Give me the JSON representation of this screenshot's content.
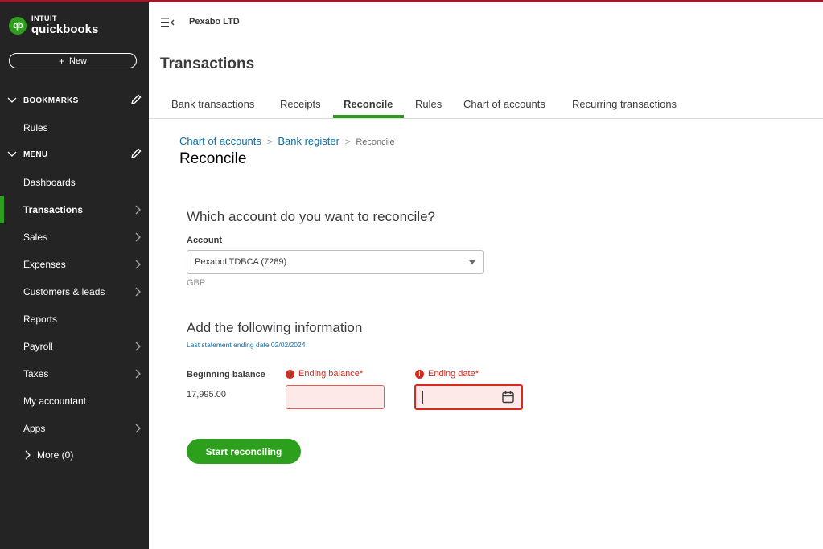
{
  "brand": {
    "intuit": "INTUIT",
    "product": "quickbooks",
    "mark": "qb",
    "accent_color": "#2ca01c",
    "sidebar_bg": "#242424"
  },
  "sidebar": {
    "new_label": "New",
    "bookmarks_label": "BOOKMARKS",
    "bookmarks": [
      {
        "label": "Rules"
      }
    ],
    "menu_label": "MENU",
    "items": [
      {
        "label": "Dashboards",
        "has_submenu": false
      },
      {
        "label": "Transactions",
        "has_submenu": true,
        "active": true
      },
      {
        "label": "Sales",
        "has_submenu": true
      },
      {
        "label": "Expenses",
        "has_submenu": true
      },
      {
        "label": "Customers & leads",
        "has_submenu": true
      },
      {
        "label": "Reports",
        "has_submenu": false
      },
      {
        "label": "Payroll",
        "has_submenu": true
      },
      {
        "label": "Taxes",
        "has_submenu": true
      },
      {
        "label": "My accountant",
        "has_submenu": false
      },
      {
        "label": "Apps",
        "has_submenu": true
      }
    ],
    "more_label": "More (0)"
  },
  "header": {
    "company": "Pexabo LTD",
    "page_title": "Transactions"
  },
  "tabs": [
    {
      "label": "Bank transactions"
    },
    {
      "label": "Receipts"
    },
    {
      "label": "Reconcile",
      "active": true
    },
    {
      "label": "Rules"
    },
    {
      "label": "Chart of accounts"
    },
    {
      "label": "Recurring transactions"
    }
  ],
  "breadcrumb": {
    "item1": "Chart of accounts",
    "item2": "Bank register",
    "current": "Reconcile",
    "separator": ">"
  },
  "reconcile": {
    "title": "Reconcile",
    "question": "Which account do you want to reconcile?",
    "account_label": "Account",
    "account_value": "PexaboLTDBCA (7289)",
    "currency": "GBP",
    "info_title": "Add the following information",
    "last_statement": "Last statement ending date 02/02/2024",
    "beginning_balance_label": "Beginning balance",
    "beginning_balance_value": "17,995.00",
    "ending_balance_label": "Ending balance*",
    "ending_balance_value": "",
    "ending_date_label": "Ending date*",
    "ending_date_value": "",
    "error_color": "#d52b1e",
    "start_button": "Start reconciling"
  }
}
